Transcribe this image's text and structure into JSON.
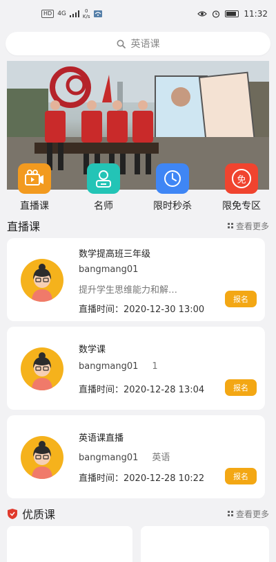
{
  "status_bar": {
    "sim_label": "HD",
    "network_label": "4G",
    "speed_value": "0",
    "speed_unit": "K/s",
    "time": "11:32"
  },
  "search": {
    "placeholder": "英语课",
    "icon": "search-icon"
  },
  "quick_menu": [
    {
      "label": "直播课",
      "icon": "live-video-icon",
      "color": "#f29a1f"
    },
    {
      "label": "名师",
      "icon": "teacher-icon",
      "color": "#23c4b6"
    },
    {
      "label": "限时秒杀",
      "icon": "clock-icon",
      "color": "#3f86f5"
    },
    {
      "label": "限免专区",
      "icon": "free-icon",
      "color": "#f0442f",
      "badge": "免"
    }
  ],
  "live_section": {
    "title": "直播课",
    "more": "查看更多"
  },
  "live_courses": [
    {
      "title": "数学提高班三年级",
      "teacher": "bangmang01",
      "extra": "",
      "desc": "提升学生思维能力和解…",
      "time": "直播时间：2020-12-30 13:00",
      "button": "报名"
    },
    {
      "title": "数学课",
      "teacher": "bangmang01",
      "extra": "1",
      "desc": "",
      "time": "直播时间：2020-12-28 13:04",
      "button": "报名"
    },
    {
      "title": "英语课直播",
      "teacher": "bangmang01",
      "extra": "英语",
      "desc": "",
      "time": "直播时间：2020-12-28 10:22",
      "button": "报名"
    }
  ],
  "quality_section": {
    "title": "优质课",
    "more": "查看更多"
  },
  "colors": {
    "accent": "#f3a714",
    "background": "#f2f2f4"
  }
}
